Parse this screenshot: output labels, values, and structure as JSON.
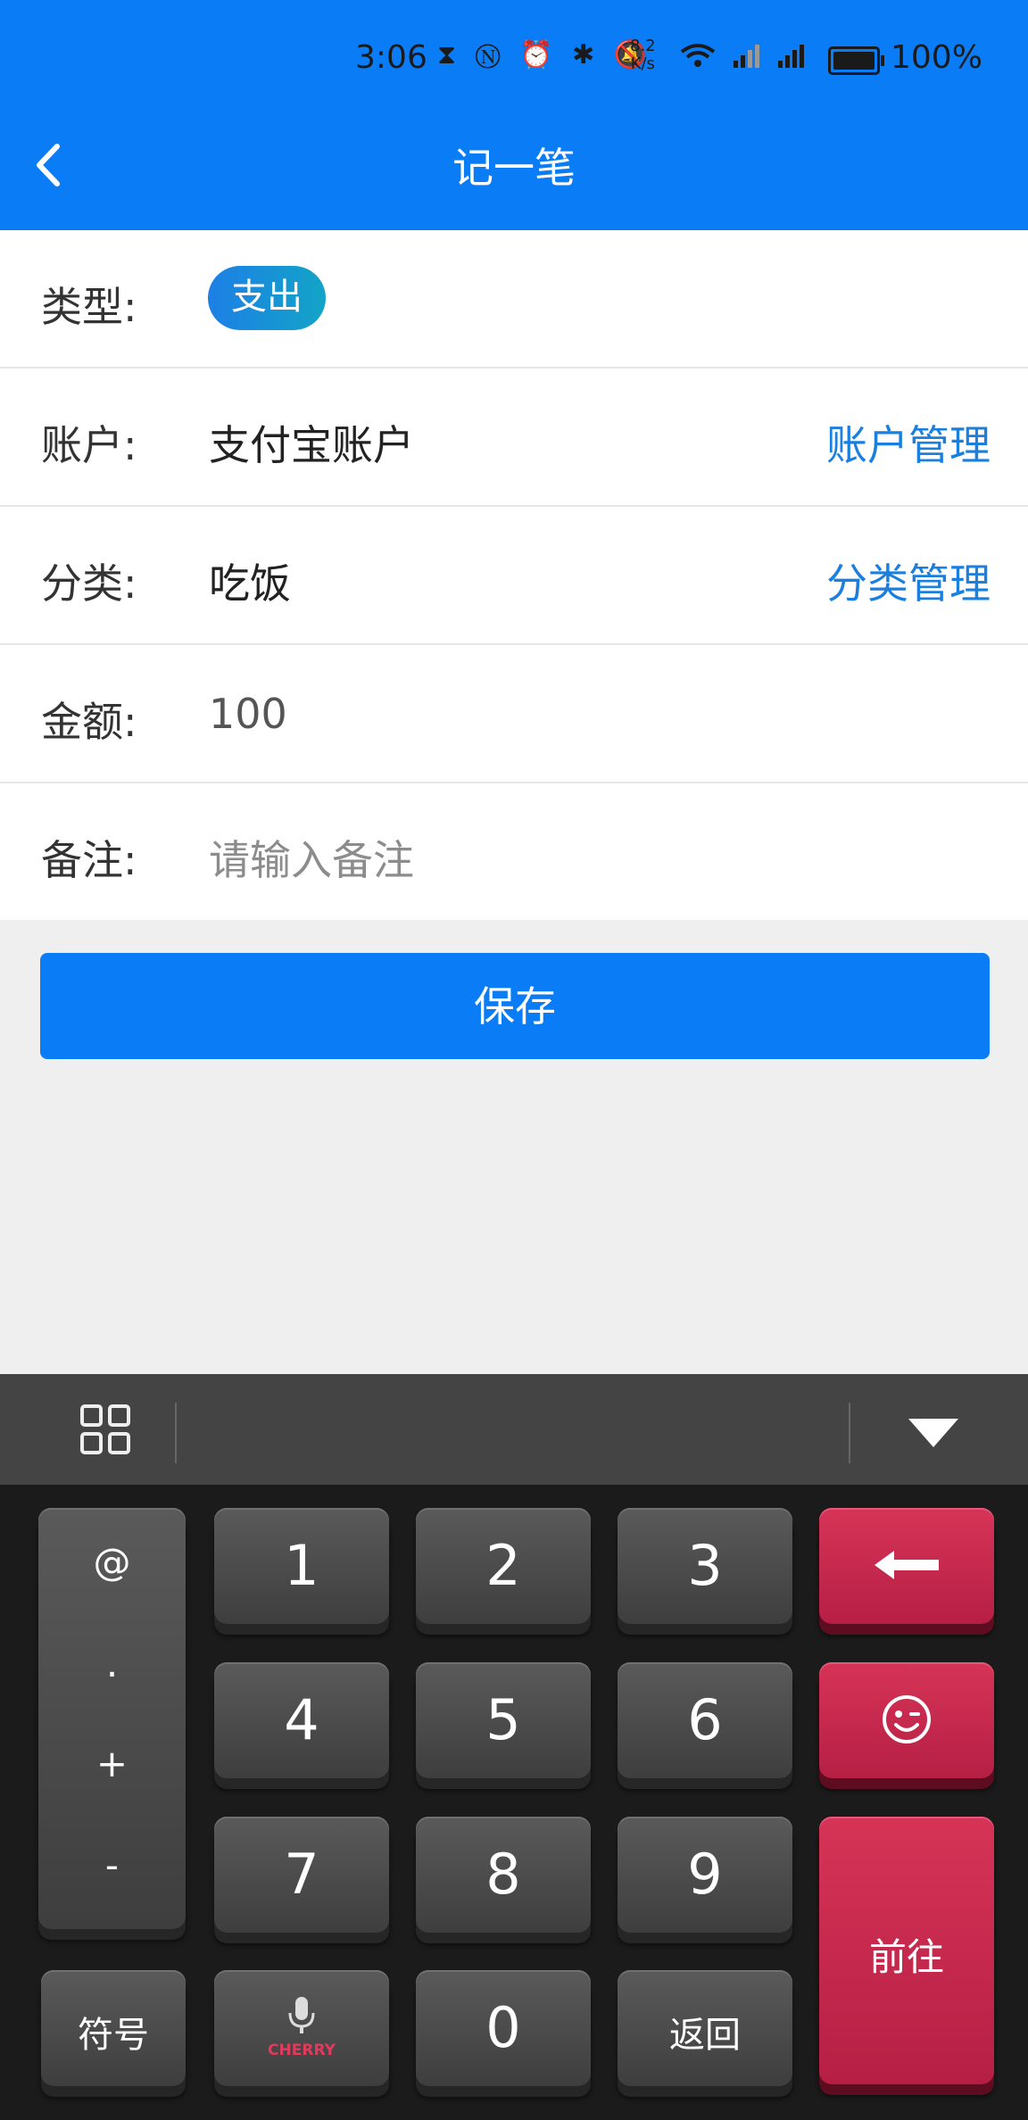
{
  "status_bar": {
    "time": "3:06",
    "speed_value": "8.2",
    "speed_unit": "K/s",
    "battery": "100%"
  },
  "header": {
    "title": "记一笔"
  },
  "form": {
    "type": {
      "label": "类型:",
      "value": "支出"
    },
    "account": {
      "label": "账户:",
      "value": "支付宝账户",
      "manage": "账户管理"
    },
    "category": {
      "label": "分类:",
      "value": "吃饭",
      "manage": "分类管理"
    },
    "amount": {
      "label": "金额:",
      "value": "100"
    },
    "note": {
      "label": "备注:",
      "placeholder": "请输入备注"
    }
  },
  "save_label": "保存",
  "keyboard": {
    "left_column": [
      "@",
      ".",
      "+",
      "-"
    ],
    "digits": [
      "1",
      "2",
      "3",
      "4",
      "5",
      "6",
      "7",
      "8",
      "9",
      "0"
    ],
    "symbols_label": "符号",
    "voice_brand": "CHERRY",
    "back_label": "返回",
    "go_label": "前往"
  },
  "colors": {
    "primary": "#0a7df6",
    "key_red": "#c8294e",
    "key_dark": "#4a4a4a"
  }
}
